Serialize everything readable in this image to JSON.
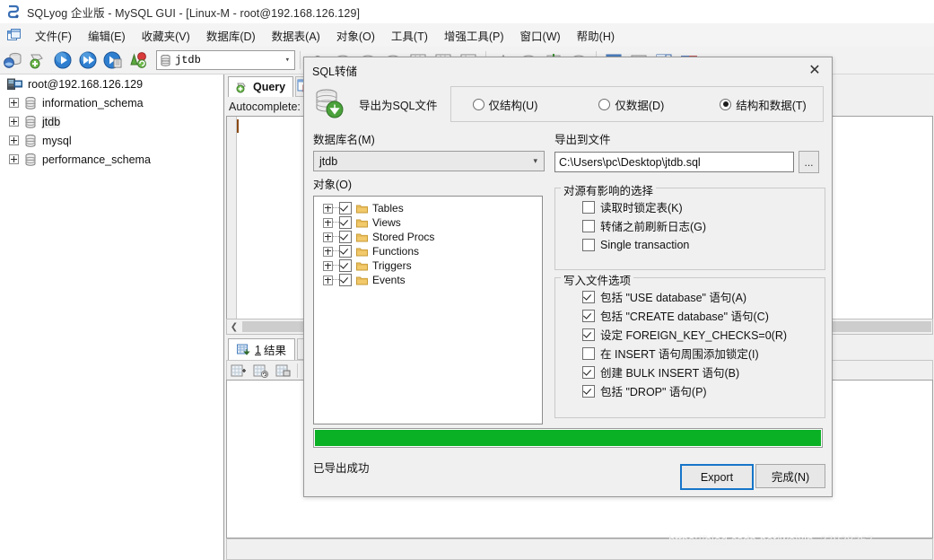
{
  "window": {
    "title": "SQLyog 企业版 - MySQL GUI - [Linux-M - root@192.168.126.129]",
    "app_icon": "sqlyog-icon",
    "mdi_icon": "mdi-window-icon"
  },
  "menubar": {
    "items": [
      {
        "label": "文件(F)",
        "name": "menu-file"
      },
      {
        "label": "编辑(E)",
        "name": "menu-edit"
      },
      {
        "label": "收藏夹(V)",
        "name": "menu-favorites"
      },
      {
        "label": "数据库(D)",
        "name": "menu-database"
      },
      {
        "label": "数据表(A)",
        "name": "menu-table"
      },
      {
        "label": "对象(O)",
        "name": "menu-objects"
      },
      {
        "label": "工具(T)",
        "name": "menu-tools"
      },
      {
        "label": "增强工具(P)",
        "name": "menu-powertools"
      },
      {
        "label": "窗口(W)",
        "name": "menu-window"
      },
      {
        "label": "帮助(H)",
        "name": "menu-help"
      }
    ]
  },
  "toolbar": {
    "db_combo_value": "jtdb",
    "db_combo_chevron": "▾"
  },
  "tree": {
    "root": "root@192.168.126.129",
    "items": [
      {
        "label": "information_schema",
        "selected": false
      },
      {
        "label": "jtdb",
        "selected": true
      },
      {
        "label": "mysql",
        "selected": false
      },
      {
        "label": "performance_schema",
        "selected": false
      }
    ]
  },
  "workspace": {
    "query_tab": "Query",
    "autocomplete_label": "Autocomplete:",
    "result_tab_number": "1",
    "result_tab_label": "结果",
    "scroll_left_arrow": "❮"
  },
  "dialog": {
    "title": "SQL转储",
    "close_glyph": "✕",
    "export_caption": "导出为SQL文件",
    "export_icon": "database-export-icon",
    "mode_options": [
      {
        "label": "仅结构(U)",
        "selected": false
      },
      {
        "label": "仅数据(D)",
        "selected": false
      },
      {
        "label": "结构和数据(T)",
        "selected": true
      }
    ],
    "dbname_label": "数据库名(M)",
    "dbname_value": "jtdb",
    "dbname_chevron": "▾",
    "exportfile_label": "导出到文件",
    "exportfile_value": "C:\\Users\\pc\\Desktop\\jtdb.sql",
    "browse_label": "...",
    "objects_label": "对象(O)",
    "objects": [
      {
        "label": "Tables",
        "checked": true
      },
      {
        "label": "Views",
        "checked": true
      },
      {
        "label": "Stored Procs",
        "checked": true
      },
      {
        "label": "Functions",
        "checked": true
      },
      {
        "label": "Triggers",
        "checked": true
      },
      {
        "label": "Events",
        "checked": true
      }
    ],
    "source_group_label": "对源有影响的选择",
    "source_options": [
      {
        "label": "读取时锁定表(K)",
        "checked": false
      },
      {
        "label": "转储之前刷新日志(G)",
        "checked": false
      },
      {
        "label": "Single transaction",
        "checked": false
      }
    ],
    "write_group_label": "写入文件选项",
    "write_options": [
      {
        "label": "包括 \"USE database\" 语句(A)",
        "checked": true
      },
      {
        "label": "包括 \"CREATE database\" 语句(C)",
        "checked": true
      },
      {
        "label": "设定 FOREIGN_KEY_CHECKS=0(R)",
        "checked": true
      },
      {
        "label": "在 INSERT 语句周围添加锁定(I)",
        "checked": false
      },
      {
        "label": "创建 BULK INSERT 语句(B)",
        "checked": true
      },
      {
        "label": "包括 \"DROP\" 语句(P)",
        "checked": true
      }
    ],
    "progress_percent": 100,
    "progress_color": "#0bb125",
    "status_text": "已导出成功",
    "export_button": "Export",
    "done_button": "完成(N)"
  },
  "watermark": {
    "text": "https://blog.csdn.net/weixin_37928367"
  }
}
